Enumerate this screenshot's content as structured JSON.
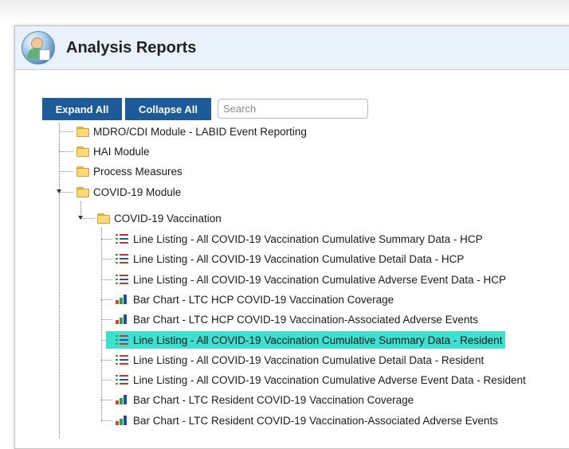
{
  "header": {
    "title": "Analysis Reports"
  },
  "toolbar": {
    "expand_label": "Expand All",
    "collapse_label": "Collapse All",
    "search_placeholder": "Search"
  },
  "tree": {
    "modules": [
      {
        "label": "MDRO/CDI Module - LABID Event Reporting",
        "icon": "folder-icon",
        "expanded": false
      },
      {
        "label": "HAI Module",
        "icon": "folder-icon",
        "expanded": false
      },
      {
        "label": "Process Measures",
        "icon": "folder-icon",
        "expanded": false
      },
      {
        "label": "COVID-19 Module",
        "icon": "folder-icon",
        "expanded": true
      }
    ],
    "vaccination_folder": {
      "label": "COVID-19 Vaccination",
      "icon": "folder-icon",
      "expanded": true
    },
    "reports": [
      {
        "label": "Line Listing - All COVID-19 Vaccination Cumulative Summary Data - HCP",
        "icon": "line-listing-icon"
      },
      {
        "label": "Line Listing - All COVID-19 Vaccination Cumulative Detail Data - HCP",
        "icon": "line-listing-icon"
      },
      {
        "label": "Line Listing - All COVID-19 Vaccination Cumulative Adverse Event Data - HCP",
        "icon": "line-listing-icon"
      },
      {
        "label": "Bar Chart - LTC HCP COVID-19 Vaccination Coverage",
        "icon": "bar-chart-icon"
      },
      {
        "label": "Bar Chart - LTC HCP COVID-19 Vaccination-Associated Adverse Events",
        "icon": "bar-chart-icon"
      },
      {
        "label": "Line Listing - All COVID-19 Vaccination Cumulative Summary Data - Resident",
        "icon": "line-listing-icon",
        "selected": true
      },
      {
        "label": "Line Listing - All COVID-19 Vaccination Cumulative Detail Data - Resident",
        "icon": "line-listing-icon"
      },
      {
        "label": "Line Listing - All COVID-19 Vaccination Cumulative Adverse Event Data - Resident",
        "icon": "line-listing-icon"
      },
      {
        "label": "Bar Chart - LTC Resident COVID-19 Vaccination Coverage",
        "icon": "bar-chart-icon"
      },
      {
        "label": "Bar Chart - LTC Resident COVID-19 Vaccination-Associated Adverse Events",
        "icon": "bar-chart-icon"
      }
    ]
  },
  "colors": {
    "button_bg": "#1d5a99",
    "header_bg": "#e9f2fb",
    "selected_bg": "#40e0d0",
    "folder": "#ffd978"
  }
}
